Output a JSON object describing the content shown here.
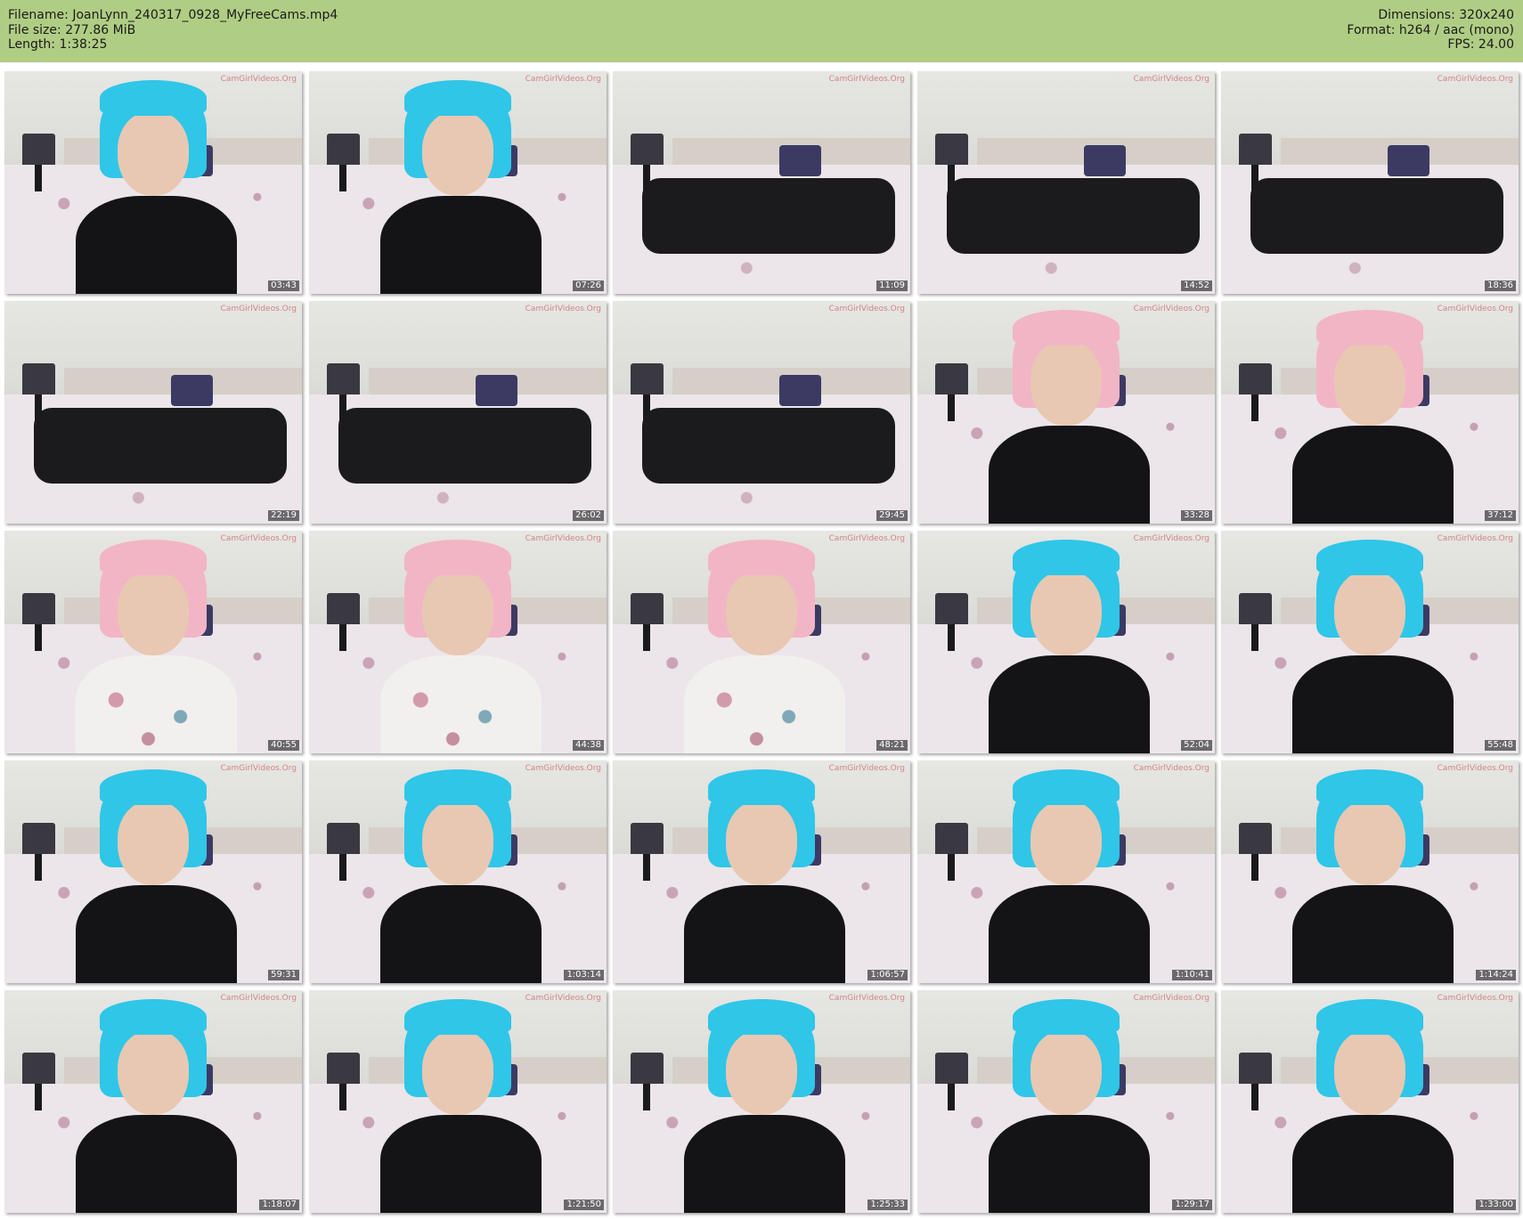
{
  "header": {
    "filename_label": "Filename:",
    "filename": "JoanLynn_240317_0928_MyFreeCams.mp4",
    "filesize_label": "File size:",
    "filesize": "277.86 MiB",
    "length_label": "Length:",
    "length": "1:38:25",
    "dimensions_label": "Dimensions:",
    "dimensions": "320x240",
    "format_label": "Format:",
    "format": "h264 / aac (mono)",
    "fps_label": "FPS:",
    "fps": "24.00"
  },
  "colors": {
    "header_bg": "#b0cd84",
    "hair_blue": "#2fc6e8",
    "hair_pink": "#f2b5c6"
  },
  "watermark": "CamGirlVideos.Org",
  "thumbnails": [
    {
      "time": "03:43",
      "scene": "blue"
    },
    {
      "time": "07:26",
      "scene": "blue"
    },
    {
      "time": "11:09",
      "scene": "legs"
    },
    {
      "time": "14:52",
      "scene": "legs"
    },
    {
      "time": "18:36",
      "scene": "legs"
    },
    {
      "time": "22:19",
      "scene": "legs"
    },
    {
      "time": "26:02",
      "scene": "legs"
    },
    {
      "time": "29:45",
      "scene": "legs"
    },
    {
      "time": "33:28",
      "scene": "pink"
    },
    {
      "time": "37:12",
      "scene": "pink"
    },
    {
      "time": "40:55",
      "scene": "pink-floral"
    },
    {
      "time": "44:38",
      "scene": "pink-floral"
    },
    {
      "time": "48:21",
      "scene": "pink-floral"
    },
    {
      "time": "52:04",
      "scene": "blue"
    },
    {
      "time": "55:48",
      "scene": "blue"
    },
    {
      "time": "59:31",
      "scene": "blue"
    },
    {
      "time": "1:03:14",
      "scene": "blue"
    },
    {
      "time": "1:06:57",
      "scene": "blue"
    },
    {
      "time": "1:10:41",
      "scene": "blue"
    },
    {
      "time": "1:14:24",
      "scene": "blue"
    },
    {
      "time": "1:18:07",
      "scene": "blue"
    },
    {
      "time": "1:21:50",
      "scene": "blue"
    },
    {
      "time": "1:25:33",
      "scene": "blue"
    },
    {
      "time": "1:29:17",
      "scene": "blue"
    },
    {
      "time": "1:33:00",
      "scene": "blue"
    }
  ]
}
